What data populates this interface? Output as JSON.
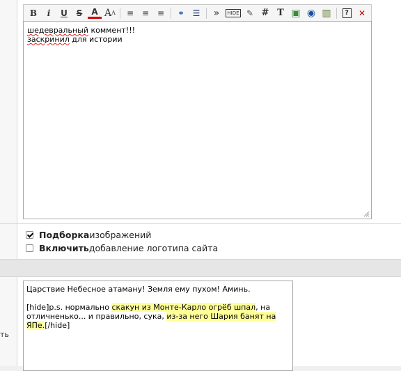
{
  "toolbar": {
    "buttons": [
      {
        "name": "bold-button",
        "glyph": "B"
      },
      {
        "name": "italic-button",
        "glyph": "i"
      },
      {
        "name": "underline-button",
        "glyph": "U"
      },
      {
        "name": "strikethrough-button",
        "glyph": "S"
      },
      {
        "name": "text-color-button",
        "glyph": "A"
      },
      {
        "name": "font-size-button",
        "glyph": "A"
      },
      {
        "name": "align-left-button",
        "glyph": "≡"
      },
      {
        "name": "align-center-button",
        "glyph": "≡"
      },
      {
        "name": "align-right-button",
        "glyph": "≡"
      },
      {
        "name": "link-button",
        "glyph": "⚭"
      },
      {
        "name": "bullet-list-button",
        "glyph": "☰"
      },
      {
        "name": "quote-button",
        "glyph": "»"
      },
      {
        "name": "hide-button",
        "glyph": "HIDE"
      },
      {
        "name": "edit-button",
        "glyph": "✎"
      },
      {
        "name": "hash-button",
        "glyph": "#"
      },
      {
        "name": "text-button",
        "glyph": "T"
      },
      {
        "name": "image-button",
        "glyph": "▣"
      },
      {
        "name": "flash-button",
        "glyph": "◉"
      },
      {
        "name": "video-button",
        "glyph": "▥"
      },
      {
        "name": "help-button",
        "glyph": "?"
      },
      {
        "name": "close-button",
        "glyph": "✕"
      }
    ]
  },
  "editor": {
    "line1_a": "шедевральный",
    "line1_b": " коммент!!!",
    "line2_a": "заскринил",
    "line2_b": " для истории"
  },
  "options": {
    "gallery_bold": "Подборка",
    "gallery_rest": " изображений",
    "logo_bold": "Включить",
    "logo_rest": " добавление логотипа сайта"
  },
  "side": {
    "label": "ть"
  },
  "textarea2": {
    "p1": "Царствие Небесное атаману! Земля ему пухом! Аминь.",
    "p2_a": "[hide]p.s. нормально ",
    "p2_h1": "скакун из Монте-Карло огрёб шпал",
    "p2_b": ", на",
    "p3_a": "отличненько... и правильно, сука, ",
    "p3_h2": "из-за него Шария банят на",
    "p4_h3": "ЯПе.",
    "p4_b": "[/hide]"
  }
}
